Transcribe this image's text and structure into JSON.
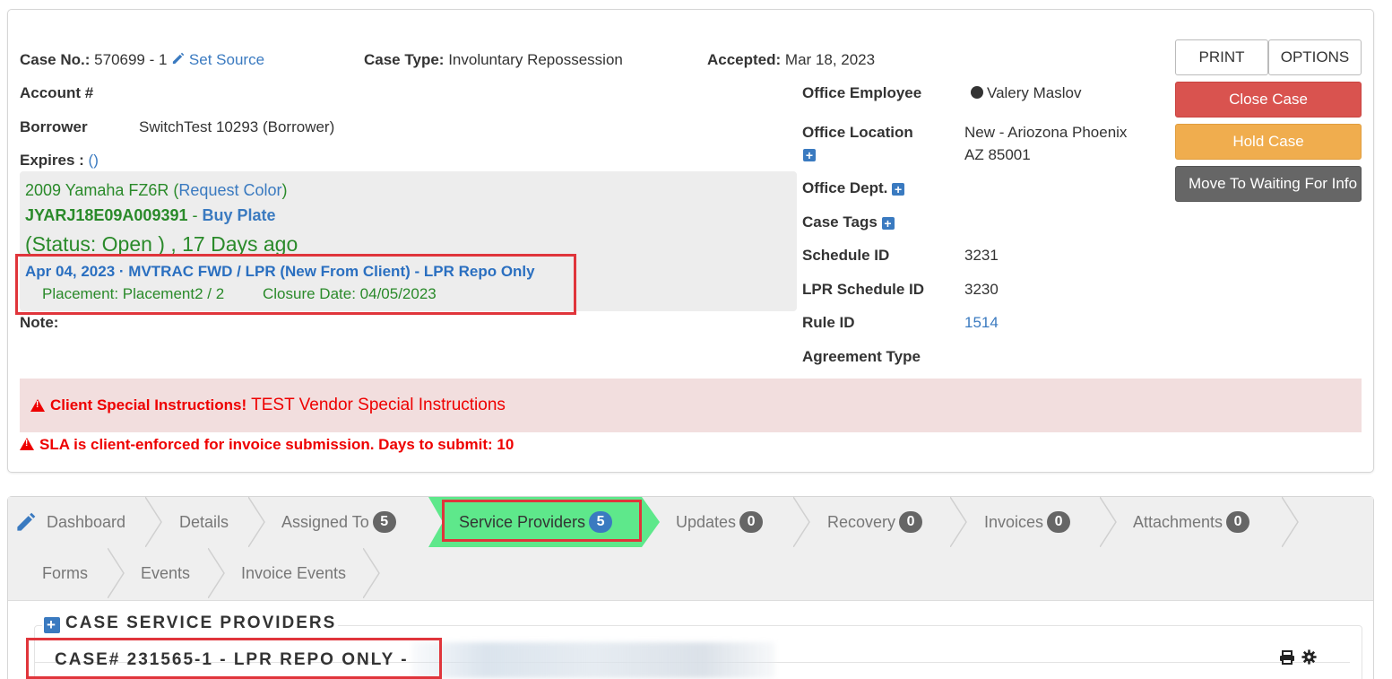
{
  "case": {
    "case_no_label": "Case No.:",
    "case_no": "570699 - 1",
    "set_source": "Set Source",
    "case_type_label": "Case Type:",
    "case_type": "Involuntary Repossession",
    "accepted_label": "Accepted:",
    "accepted": "Mar 18, 2023",
    "account_label": "Account #",
    "borrower_label": "Borrower",
    "borrower": "SwitchTest 10293 (Borrower)",
    "expires_label": "Expires :",
    "expires": "()",
    "note_label": "Note:"
  },
  "vehicle": {
    "name": "2009 Yamaha FZ6R (",
    "request_color": "Request Color",
    "close_paren": ")",
    "vin": "JYARJ18E09A009391",
    "dash": " - ",
    "buy_plate": "Buy Plate",
    "status": "(Status: Open ) , 17 Days ago",
    "placement_header": "Apr 04, 2023 · MVTRAC FWD / LPR (New From Client) - LPR Repo Only",
    "placement": "Placement: Placement2 / 2",
    "closure_date": "Closure Date: 04/05/2023"
  },
  "office": {
    "employee_label": "Office Employee",
    "employee": "Valery Maslov",
    "location_label": "Office Location",
    "location_line1": "New - Ariozona Phoenix",
    "location_line2": "AZ 85001",
    "dept_label": "Office Dept.",
    "tags_label": "Case Tags",
    "schedule_id_label": "Schedule ID",
    "schedule_id": "3231",
    "lpr_schedule_id_label": "LPR Schedule ID",
    "lpr_schedule_id": "3230",
    "rule_id_label": "Rule ID",
    "rule_id": "1514",
    "agreement_type_label": "Agreement Type"
  },
  "actions": {
    "print": "PRINT",
    "options": "OPTIONS",
    "close_case": "Close Case",
    "hold_case": "Hold Case",
    "move_waiting": "Move To Waiting For Info"
  },
  "alerts": {
    "client_special_label": "Client Special Instructions!",
    "client_special_text": "TEST Vendor Special Instructions",
    "sla": "SLA is client-enforced for invoice submission. Days to submit: 10"
  },
  "tabs": [
    {
      "label": "Dashboard"
    },
    {
      "label": "Details"
    },
    {
      "label": "Assigned To",
      "count": "5"
    },
    {
      "label": "Service Providers",
      "count": "5"
    },
    {
      "label": "Updates",
      "count": "0"
    },
    {
      "label": "Recovery",
      "count": "0"
    },
    {
      "label": "Invoices",
      "count": "0"
    },
    {
      "label": "Attachments",
      "count": "0"
    },
    {
      "label": "Forms"
    },
    {
      "label": "Events"
    },
    {
      "label": "Invoice Events"
    }
  ],
  "section": {
    "title": "CASE SERVICE PROVIDERS",
    "case_header": "CASE# 231565-1 - LPR REPO ONLY -"
  },
  "colors": {
    "danger": "#d9534f",
    "warning": "#f0ad4e",
    "dark": "#666666",
    "active_tab": "#5ee88b",
    "highlight_border": "#e0353b"
  }
}
